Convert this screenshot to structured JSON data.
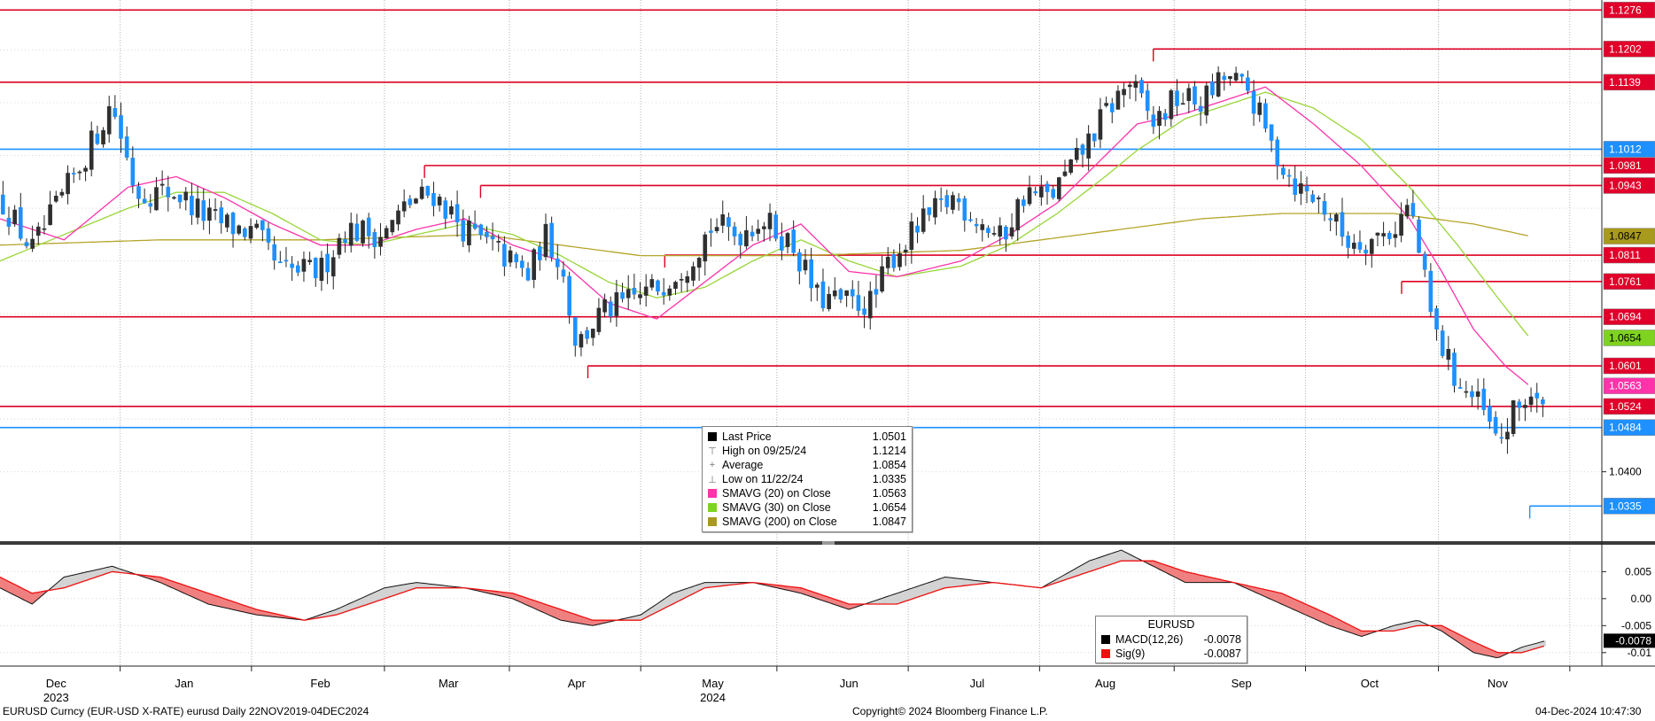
{
  "footer": {
    "left": "EURUSD Curncy (EUR-USD X-RATE) eurusd  Daily 22NOV2019-04DEC2024",
    "center": "Copyright© 2024 Bloomberg Finance L.P.",
    "right": "04-Dec-2024 10:47:30"
  },
  "legend_main": {
    "rows": [
      {
        "label": "Last Price",
        "value": "1.0501",
        "swatch": "#000000",
        "glyph": ""
      },
      {
        "label": "High on 09/25/24",
        "value": "1.1214",
        "swatch": "",
        "glyph": "⊤"
      },
      {
        "label": "Average",
        "value": "1.0854",
        "swatch": "",
        "glyph": "+"
      },
      {
        "label": "Low on 11/22/24",
        "value": "1.0335",
        "swatch": "",
        "glyph": "⊥"
      },
      {
        "label": "SMAVG (20)  on Close",
        "value": "1.0563",
        "swatch": "#ff33aa",
        "glyph": ""
      },
      {
        "label": "SMAVG (30)  on Close",
        "value": "1.0654",
        "swatch": "#7ed321",
        "glyph": ""
      },
      {
        "label": "SMAVG (200)  on Close",
        "value": "1.0847",
        "swatch": "#a89a1c",
        "glyph": ""
      }
    ]
  },
  "legend_macd": {
    "title": "EURUSD",
    "rows": [
      {
        "label": "MACD(12,26)",
        "value": "-0.0078",
        "swatch": "#000000"
      },
      {
        "label": "Sig(9)",
        "value": "-0.0087",
        "swatch": "#ee1111"
      }
    ]
  },
  "chart_data": {
    "type": "candlestick",
    "price_axis": {
      "range": [
        1.027,
        1.1295
      ],
      "ticks": [
        1.04,
        1.05,
        1.06,
        1.07,
        1.08,
        1.09,
        1.1,
        1.11,
        1.12
      ],
      "visible_tick_labels": [
        "1.0400"
      ]
    },
    "macd_axis": {
      "range": [
        -0.0125,
        0.0095
      ],
      "ticks": [
        0.005,
        0.0,
        -0.005,
        -0.01
      ],
      "tick_labels": [
        "0.005",
        "0.00",
        "-0.005",
        "-0.01"
      ]
    },
    "x_axis": {
      "months": [
        {
          "label": "Dec",
          "year": "2023",
          "pos": 0.035
        },
        {
          "label": "Jan",
          "year": "",
          "pos": 0.115
        },
        {
          "label": "Feb",
          "year": "",
          "pos": 0.2
        },
        {
          "label": "Mar",
          "year": "",
          "pos": 0.28
        },
        {
          "label": "Apr",
          "year": "",
          "pos": 0.36
        },
        {
          "label": "May",
          "year": "2024",
          "pos": 0.445
        },
        {
          "label": "Jun",
          "year": "",
          "pos": 0.53
        },
        {
          "label": "Jul",
          "year": "",
          "pos": 0.61
        },
        {
          "label": "Aug",
          "year": "",
          "pos": 0.69
        },
        {
          "label": "Sep",
          "year": "",
          "pos": 0.775
        },
        {
          "label": "Oct",
          "year": "",
          "pos": 0.855
        },
        {
          "label": "Nov",
          "year": "",
          "pos": 0.935
        }
      ],
      "gridlines": [
        0.075,
        0.157,
        0.24,
        0.318,
        0.4,
        0.485,
        0.567,
        0.649,
        0.733,
        0.815,
        0.898,
        0.98
      ]
    },
    "levels": [
      {
        "value": 1.1276,
        "label": "1.1276",
        "type": "resistance",
        "from": 0.0,
        "color": "#dd0022"
      },
      {
        "value": 1.1202,
        "label": "1.1202",
        "type": "resistance",
        "from": 0.72,
        "color": "#dd0022"
      },
      {
        "value": 1.1139,
        "label": "1.1139",
        "type": "resistance",
        "from": 0.0,
        "color": "#dd0022"
      },
      {
        "value": 1.1012,
        "label": "1.1012",
        "type": "support",
        "from": 0.0,
        "color": "#1e90ff"
      },
      {
        "value": 1.0981,
        "label": "1.0981",
        "type": "resistance",
        "from": 0.265,
        "color": "#dd0022"
      },
      {
        "value": 1.0943,
        "label": "1.0943",
        "type": "resistance",
        "from": 0.3,
        "color": "#dd0022"
      },
      {
        "value": 1.0811,
        "label": "1.0811",
        "type": "resistance",
        "from": 0.415,
        "color": "#dd0022"
      },
      {
        "value": 1.0761,
        "label": "1.0761",
        "type": "resistance",
        "from": 0.875,
        "color": "#dd0022"
      },
      {
        "value": 1.0694,
        "label": "1.0694",
        "type": "resistance",
        "from": 0.0,
        "color": "#dd0022"
      },
      {
        "value": 1.0601,
        "label": "1.0601",
        "type": "resistance",
        "from": 0.367,
        "color": "#dd0022"
      },
      {
        "value": 1.0524,
        "label": "1.0524",
        "type": "resistance",
        "from": 0.0,
        "color": "#dd0022"
      },
      {
        "value": 1.0484,
        "label": "1.0484",
        "type": "support",
        "from": 0.0,
        "color": "#1e90ff"
      },
      {
        "value": 1.0335,
        "label": "1.0335",
        "type": "support",
        "from": 0.955,
        "color": "#1e90ff"
      }
    ],
    "ma_labels": [
      {
        "name": "SMAVG (200)",
        "value": 1.0847,
        "label": "1.0847",
        "color": "#a89a1c"
      },
      {
        "name": "SMAVG (30)",
        "value": 1.0654,
        "label": "1.0654",
        "color": "#7ed321"
      },
      {
        "name": "SMAVG (20)",
        "value": 1.0563,
        "label": "1.0563",
        "color": "#ff33aa"
      }
    ],
    "close_path": [
      [
        0.0,
        1.092
      ],
      [
        0.02,
        1.082
      ],
      [
        0.035,
        1.09
      ],
      [
        0.05,
        1.098
      ],
      [
        0.07,
        1.11
      ],
      [
        0.085,
        1.093
      ],
      [
        0.11,
        1.093
      ],
      [
        0.13,
        1.088
      ],
      [
        0.16,
        1.085
      ],
      [
        0.175,
        1.078
      ],
      [
        0.2,
        1.078
      ],
      [
        0.215,
        1.086
      ],
      [
        0.24,
        1.085
      ],
      [
        0.255,
        1.091
      ],
      [
        0.27,
        1.093
      ],
      [
        0.29,
        1.086
      ],
      [
        0.31,
        1.082
      ],
      [
        0.33,
        1.077
      ],
      [
        0.34,
        1.085
      ],
      [
        0.35,
        1.08
      ],
      [
        0.36,
        1.064
      ],
      [
        0.375,
        1.07
      ],
      [
        0.39,
        1.072
      ],
      [
        0.41,
        1.075
      ],
      [
        0.43,
        1.08
      ],
      [
        0.445,
        1.087
      ],
      [
        0.46,
        1.085
      ],
      [
        0.475,
        1.088
      ],
      [
        0.495,
        1.083
      ],
      [
        0.51,
        1.073
      ],
      [
        0.53,
        1.072
      ],
      [
        0.545,
        1.072
      ],
      [
        0.555,
        1.08
      ],
      [
        0.575,
        1.087
      ],
      [
        0.595,
        1.092
      ],
      [
        0.61,
        1.088
      ],
      [
        0.625,
        1.084
      ],
      [
        0.64,
        1.093
      ],
      [
        0.655,
        1.092
      ],
      [
        0.67,
        1.098
      ],
      [
        0.69,
        1.108
      ],
      [
        0.705,
        1.114
      ],
      [
        0.72,
        1.106
      ],
      [
        0.735,
        1.111
      ],
      [
        0.75,
        1.11
      ],
      [
        0.765,
        1.115
      ],
      [
        0.78,
        1.112
      ],
      [
        0.795,
        1.101
      ],
      [
        0.81,
        1.094
      ],
      [
        0.825,
        1.091
      ],
      [
        0.84,
        1.084
      ],
      [
        0.855,
        1.084
      ],
      [
        0.87,
        1.086
      ],
      [
        0.88,
        1.091
      ],
      [
        0.895,
        1.067
      ],
      [
        0.91,
        1.057
      ],
      [
        0.925,
        1.052
      ],
      [
        0.935,
        1.045
      ],
      [
        0.945,
        1.051
      ],
      [
        0.955,
        1.055
      ],
      [
        0.965,
        1.0501
      ]
    ],
    "sma20_path": [
      [
        0.0,
        1.088
      ],
      [
        0.04,
        1.084
      ],
      [
        0.08,
        1.094
      ],
      [
        0.11,
        1.096
      ],
      [
        0.14,
        1.092
      ],
      [
        0.17,
        1.087
      ],
      [
        0.2,
        1.083
      ],
      [
        0.23,
        1.083
      ],
      [
        0.26,
        1.086
      ],
      [
        0.29,
        1.088
      ],
      [
        0.32,
        1.083
      ],
      [
        0.35,
        1.08
      ],
      [
        0.38,
        1.072
      ],
      [
        0.41,
        1.069
      ],
      [
        0.44,
        1.076
      ],
      [
        0.47,
        1.083
      ],
      [
        0.5,
        1.087
      ],
      [
        0.53,
        1.078
      ],
      [
        0.56,
        1.077
      ],
      [
        0.6,
        1.08
      ],
      [
        0.63,
        1.085
      ],
      [
        0.66,
        1.091
      ],
      [
        0.69,
        1.1
      ],
      [
        0.71,
        1.106
      ],
      [
        0.74,
        1.108
      ],
      [
        0.77,
        1.111
      ],
      [
        0.79,
        1.113
      ],
      [
        0.82,
        1.106
      ],
      [
        0.85,
        1.098
      ],
      [
        0.88,
        1.088
      ],
      [
        0.9,
        1.078
      ],
      [
        0.92,
        1.067
      ],
      [
        0.94,
        1.06
      ],
      [
        0.955,
        1.0563
      ]
    ],
    "sma30_path": [
      [
        0.0,
        1.08
      ],
      [
        0.04,
        1.085
      ],
      [
        0.08,
        1.09
      ],
      [
        0.11,
        1.093
      ],
      [
        0.14,
        1.093
      ],
      [
        0.17,
        1.089
      ],
      [
        0.2,
        1.084
      ],
      [
        0.23,
        1.083
      ],
      [
        0.26,
        1.085
      ],
      [
        0.29,
        1.087
      ],
      [
        0.32,
        1.085
      ],
      [
        0.35,
        1.081
      ],
      [
        0.38,
        1.076
      ],
      [
        0.41,
        1.073
      ],
      [
        0.44,
        1.075
      ],
      [
        0.47,
        1.08
      ],
      [
        0.5,
        1.084
      ],
      [
        0.53,
        1.08
      ],
      [
        0.56,
        1.077
      ],
      [
        0.6,
        1.079
      ],
      [
        0.63,
        1.083
      ],
      [
        0.66,
        1.089
      ],
      [
        0.69,
        1.096
      ],
      [
        0.71,
        1.101
      ],
      [
        0.74,
        1.107
      ],
      [
        0.77,
        1.11
      ],
      [
        0.79,
        1.112
      ],
      [
        0.82,
        1.109
      ],
      [
        0.85,
        1.103
      ],
      [
        0.88,
        1.094
      ],
      [
        0.91,
        1.083
      ],
      [
        0.935,
        1.073
      ],
      [
        0.955,
        1.0654
      ]
    ],
    "sma200_path": [
      [
        0.0,
        1.083
      ],
      [
        0.1,
        1.084
      ],
      [
        0.2,
        1.084
      ],
      [
        0.3,
        1.085
      ],
      [
        0.4,
        1.081
      ],
      [
        0.5,
        1.081
      ],
      [
        0.6,
        1.082
      ],
      [
        0.7,
        1.086
      ],
      [
        0.75,
        1.088
      ],
      [
        0.8,
        1.089
      ],
      [
        0.87,
        1.089
      ],
      [
        0.92,
        1.087
      ],
      [
        0.955,
        1.0847
      ]
    ],
    "macd_path": [
      [
        0.0,
        0.002
      ],
      [
        0.02,
        -0.001
      ],
      [
        0.04,
        0.004
      ],
      [
        0.07,
        0.006
      ],
      [
        0.1,
        0.003
      ],
      [
        0.13,
        -0.001
      ],
      [
        0.16,
        -0.003
      ],
      [
        0.19,
        -0.004
      ],
      [
        0.21,
        -0.002
      ],
      [
        0.24,
        0.002
      ],
      [
        0.26,
        0.003
      ],
      [
        0.29,
        0.002
      ],
      [
        0.32,
        0.0
      ],
      [
        0.35,
        -0.004
      ],
      [
        0.37,
        -0.005
      ],
      [
        0.4,
        -0.003
      ],
      [
        0.42,
        0.001
      ],
      [
        0.44,
        0.003
      ],
      [
        0.47,
        0.003
      ],
      [
        0.5,
        0.001
      ],
      [
        0.53,
        -0.002
      ],
      [
        0.56,
        0.001
      ],
      [
        0.59,
        0.004
      ],
      [
        0.62,
        0.003
      ],
      [
        0.65,
        0.002
      ],
      [
        0.68,
        0.007
      ],
      [
        0.7,
        0.009
      ],
      [
        0.72,
        0.006
      ],
      [
        0.74,
        0.003
      ],
      [
        0.77,
        0.003
      ],
      [
        0.8,
        -0.001
      ],
      [
        0.83,
        -0.005
      ],
      [
        0.85,
        -0.007
      ],
      [
        0.87,
        -0.005
      ],
      [
        0.885,
        -0.004
      ],
      [
        0.9,
        -0.006
      ],
      [
        0.92,
        -0.01
      ],
      [
        0.935,
        -0.011
      ],
      [
        0.95,
        -0.009
      ],
      [
        0.965,
        -0.0078
      ]
    ],
    "signal_path": [
      [
        0.0,
        0.004
      ],
      [
        0.02,
        0.001
      ],
      [
        0.04,
        0.002
      ],
      [
        0.07,
        0.005
      ],
      [
        0.1,
        0.004
      ],
      [
        0.13,
        0.001
      ],
      [
        0.16,
        -0.002
      ],
      [
        0.19,
        -0.004
      ],
      [
        0.21,
        -0.003
      ],
      [
        0.24,
        0.0
      ],
      [
        0.26,
        0.002
      ],
      [
        0.29,
        0.002
      ],
      [
        0.32,
        0.001
      ],
      [
        0.35,
        -0.002
      ],
      [
        0.37,
        -0.004
      ],
      [
        0.4,
        -0.004
      ],
      [
        0.42,
        -0.001
      ],
      [
        0.44,
        0.002
      ],
      [
        0.47,
        0.003
      ],
      [
        0.5,
        0.002
      ],
      [
        0.53,
        -0.001
      ],
      [
        0.56,
        -0.001
      ],
      [
        0.59,
        0.002
      ],
      [
        0.62,
        0.003
      ],
      [
        0.65,
        0.002
      ],
      [
        0.68,
        0.005
      ],
      [
        0.7,
        0.007
      ],
      [
        0.72,
        0.007
      ],
      [
        0.74,
        0.005
      ],
      [
        0.77,
        0.003
      ],
      [
        0.8,
        0.001
      ],
      [
        0.83,
        -0.003
      ],
      [
        0.85,
        -0.006
      ],
      [
        0.87,
        -0.006
      ],
      [
        0.885,
        -0.005
      ],
      [
        0.9,
        -0.005
      ],
      [
        0.92,
        -0.008
      ],
      [
        0.935,
        -0.01
      ],
      [
        0.95,
        -0.01
      ],
      [
        0.965,
        -0.0087
      ]
    ],
    "colors": {
      "up": "#2f2f2f",
      "down": "#1e90ff",
      "sma20": "#ff33aa",
      "sma30": "#99d63a",
      "sma200": "#b5a52a",
      "macd_fill": "#f08080",
      "macd_fill_up": "#d3d3d3",
      "signal": "#ee1111",
      "grid": "#b0b0b0"
    }
  }
}
